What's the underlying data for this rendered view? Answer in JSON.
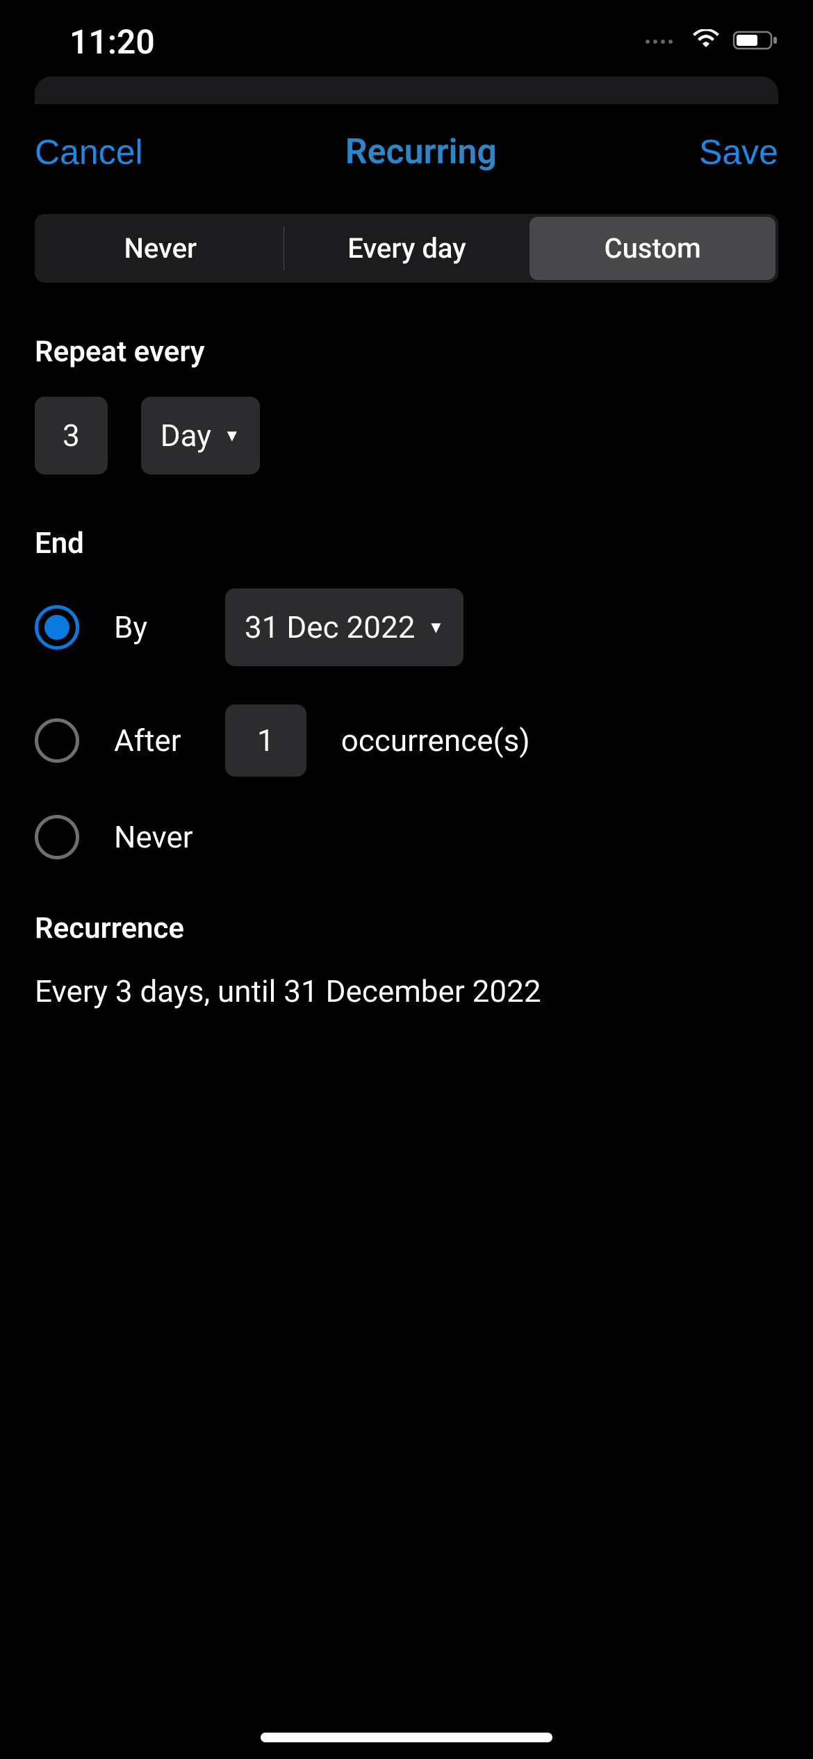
{
  "statusBar": {
    "time": "11:20"
  },
  "header": {
    "cancel": "Cancel",
    "title": "Recurring",
    "save": "Save"
  },
  "tabs": {
    "never": "Never",
    "everyDay": "Every day",
    "custom": "Custom"
  },
  "repeatSection": {
    "label": "Repeat every",
    "value": "3",
    "unit": "Day"
  },
  "endSection": {
    "label": "End",
    "byLabel": "By",
    "byDate": "31 Dec 2022",
    "afterLabel": "After",
    "afterCount": "1",
    "afterSuffix": "occurrence(s)",
    "neverLabel": "Never"
  },
  "recurrenceSection": {
    "label": "Recurrence",
    "summary": "Every 3 days, until 31 December 2022"
  }
}
